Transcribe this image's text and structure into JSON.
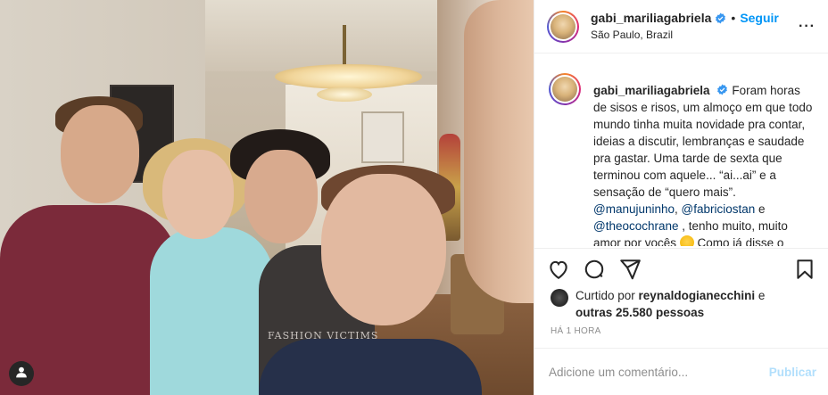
{
  "photo": {
    "shirt_text": "FASHION VICTIMS"
  },
  "post": {
    "username": "gabi_mariliagabriela",
    "dot": "•",
    "follow_label": "Seguir",
    "location": "São Paulo, Brazil",
    "more_label": "···",
    "caption_username": "gabi_mariliagabriela",
    "caption_part1": "Foram horas de sisos e risos, um almoço em que todo mundo tinha muita novidade pra contar, ideias a discutir, lembranças e saudade pra gastar. Uma tarde de sexta que terminou com aquele... “ai...ai” e a sensação de “quero mais”.",
    "mention1": "@manujuninho",
    "sep1": ", ",
    "mention2": "@fabriciostan",
    "sep2": " e ",
    "mention3": "@theocochrane",
    "caption_part2": " , tenho muito, muito amor por vocês ",
    "caption_part3": " Como já disse o",
    "liked_by_prefix": "Curtido por ",
    "liked_by_user": "reynaldogianecchini",
    "liked_by_mid": " e ",
    "liked_by_others": "outras 25.580 pessoas",
    "time": "HÁ 1 HORA",
    "comment_placeholder": "Adicione um comentário...",
    "publish_label": "Publicar"
  },
  "icons": {
    "verified": "verified-badge-icon",
    "like": "heart-icon",
    "comment": "comment-bubble-icon",
    "share": "paper-plane-icon",
    "save": "bookmark-icon",
    "tag": "user-tag-icon"
  },
  "colors": {
    "link_blue": "#0095f6",
    "mention": "#00376b",
    "muted": "#8e8e8e",
    "publish_disabled": "#b2dffc"
  }
}
